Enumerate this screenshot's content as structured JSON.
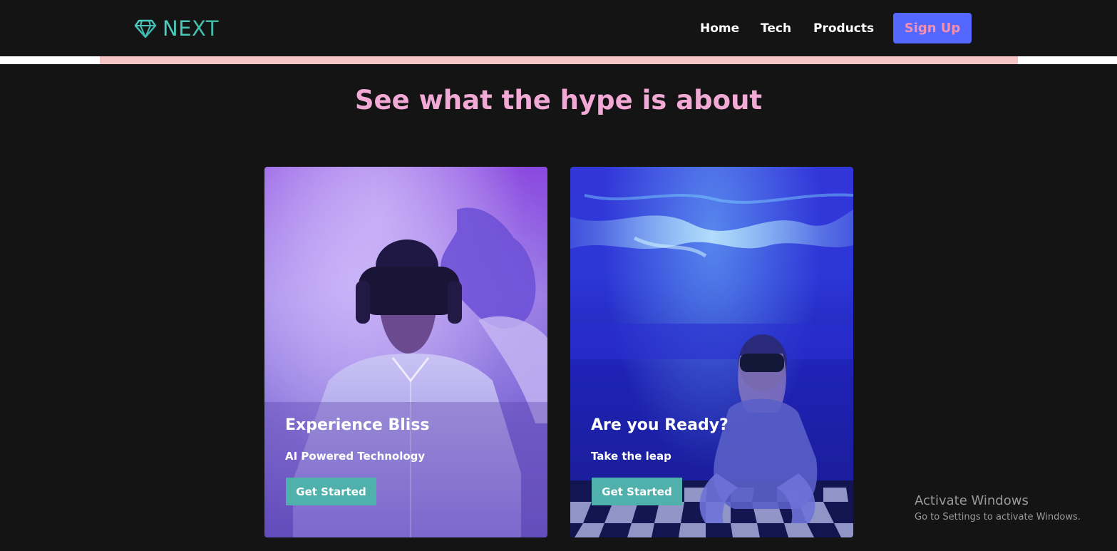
{
  "brand": {
    "name": "NEXT",
    "icon": "diamond-icon",
    "color_start": "#4fd1c5",
    "color_end": "#3fb8a0"
  },
  "nav": {
    "links": [
      {
        "label": "Home"
      },
      {
        "label": "Tech"
      },
      {
        "label": "Products"
      }
    ],
    "signup_label": "Sign Up",
    "signup_bg": "#5468ff",
    "signup_text_color": "#f48fb1"
  },
  "hero": {
    "title": "See what the hype is about",
    "title_color": "#f2a9d6"
  },
  "cards": [
    {
      "heading": "Experience Bliss",
      "subtitle": "AI Powered Technology",
      "button_label": "Get Started",
      "image": "vr-headset-man-photo"
    },
    {
      "heading": "Are you Ready?",
      "subtitle": "Take the leap",
      "button_label": "Get Started",
      "image": "vr-headset-woman-photo"
    }
  ],
  "accent_button_color": "#4fb0ac",
  "os_watermark": {
    "title": "Activate Windows",
    "subtitle": "Go to Settings to activate Windows."
  }
}
